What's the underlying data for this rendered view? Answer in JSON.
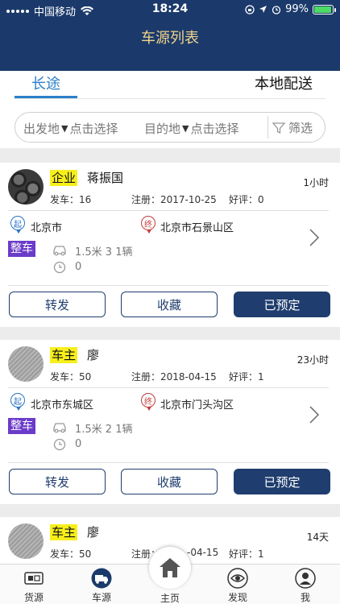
{
  "status_bar": {
    "carrier": "中国移动",
    "time": "18:24",
    "battery": "99%"
  },
  "header": {
    "title": "车源列表"
  },
  "tabs": [
    {
      "label": "长途"
    },
    {
      "label": "本地配送"
    }
  ],
  "filter": {
    "origin_label": "出发地",
    "origin_placeholder": "点击选择",
    "dest_label": "目的地",
    "dest_placeholder": "点击选择",
    "filter_label": "筛选"
  },
  "listings": [
    {
      "role": "企业",
      "name": "蒋振国",
      "time_ago": "1小时",
      "trips": "发车：16",
      "registered": "注册：2017-10-25",
      "rating": "好评：0",
      "from_badge": "起",
      "from": "北京市",
      "to_badge": "终",
      "to": "北京市石景山区",
      "truck_type": "整车",
      "spec": "1.5米 3 1辆",
      "count": "0",
      "btn_forward": "转发",
      "btn_favorite": "收藏",
      "btn_booked": "已预定"
    },
    {
      "role": "车主",
      "name": "廖",
      "time_ago": "23小时",
      "trips": "发车：50",
      "registered": "注册：2018-04-15",
      "rating": "好评：1",
      "from_badge": "起",
      "from": "北京市东城区",
      "to_badge": "终",
      "to": "北京市门头沟区",
      "truck_type": "整车",
      "spec": "1.5米 2 1辆",
      "count": "0",
      "btn_forward": "转发",
      "btn_favorite": "收藏",
      "btn_booked": "已预定"
    },
    {
      "role": "车主",
      "name": "廖",
      "time_ago": "14天",
      "trips": "发车：50",
      "registered": "注册：",
      "registered_partial": "-04-15",
      "rating": "好评：1"
    }
  ],
  "bottom_nav": [
    {
      "label": "货源",
      "icon": "cargo-source-icon"
    },
    {
      "label": "车源",
      "icon": "truck-source-icon"
    },
    {
      "label": "主页",
      "icon": "home-icon"
    },
    {
      "label": "发现",
      "icon": "eye-icon"
    },
    {
      "label": "我",
      "icon": "user-icon"
    }
  ],
  "colors": {
    "header": "#1b3a6b",
    "title": "#f2d48b",
    "accent": "#2c80c9",
    "role_tag": "#f7ef1c",
    "truck_tag": "#6b3bc9",
    "button": "#1f3d6e"
  }
}
